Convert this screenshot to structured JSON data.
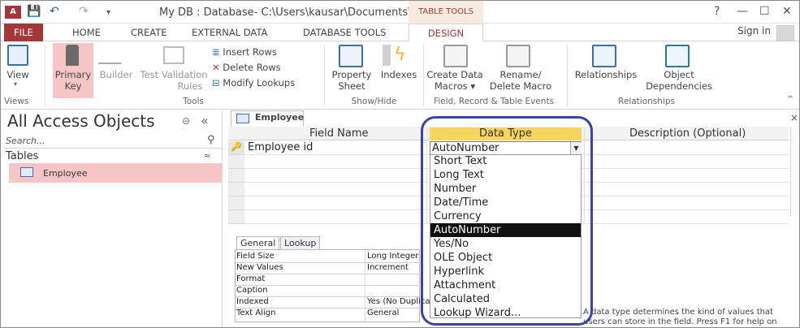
{
  "window": {
    "app_icon": "A",
    "title": "My DB : Database- C:\\Users\\kausar\\Documents\\...",
    "context_tab": "TABLE TOOLS",
    "help": "?",
    "minimize": "—",
    "maximize": "☐",
    "close": "✕"
  },
  "tabs": [
    "FILE",
    "HOME",
    "CREATE",
    "EXTERNAL DATA",
    "DATABASE TOOLS",
    "DESIGN"
  ],
  "signin": "Sign in",
  "ribbon": {
    "view": "View",
    "primary_key_1": "Primary",
    "primary_key_2": "Key",
    "builder": "Builder",
    "test_validation_1": "Test Validation",
    "test_validation_2": "Rules",
    "insert_rows": "Insert Rows",
    "delete_rows": "Delete Rows",
    "modify_lookups": "Modify Lookups",
    "property_sheet_1": "Property",
    "property_sheet_2": "Sheet",
    "indexes": "Indexes",
    "create_data_macros_1": "Create Data",
    "create_data_macros_2": "Macros ▾",
    "rename_delete_1": "Rename/",
    "rename_delete_2": "Delete Macro",
    "relationships": "Relationships",
    "object_dependencies_1": "Object",
    "object_dependencies_2": "Dependencies",
    "groups": [
      "Views",
      "Tools",
      "Show/Hide",
      "Field, Record & Table Events",
      "Relationships"
    ]
  },
  "nav": {
    "title": "All Access Objects",
    "search_placeholder": "Search...",
    "group": "Tables",
    "item": "Employee"
  },
  "doc": {
    "tab": "Employee",
    "headers": [
      "Field Name",
      "Data Type",
      "Description (Optional)"
    ],
    "field_name": "Employee id",
    "data_type": "AutoNumber",
    "options": [
      "Short Text",
      "Long Text",
      "Number",
      "Date/Time",
      "Currency",
      "AutoNumber",
      "Yes/No",
      "OLE Object",
      "Hyperlink",
      "Attachment",
      "Calculated",
      "Lookup Wizard..."
    ],
    "selected_option": "AutoNumber"
  },
  "props": {
    "tabs": [
      "General",
      "Lookup"
    ],
    "rows": [
      {
        "label": "Field Size",
        "value": "Long Integer"
      },
      {
        "label": "New Values",
        "value": "Increment"
      },
      {
        "label": "Format",
        "value": ""
      },
      {
        "label": "Caption",
        "value": ""
      },
      {
        "label": "Indexed",
        "value": "Yes (No Duplicates)"
      },
      {
        "label": "Text Align",
        "value": "General"
      }
    ],
    "help_text": "A data type determines the kind of values that users can store in the field. Press F1 for help on"
  },
  "colors": {
    "accent": "#a4373a",
    "highlight": "#3a44a8",
    "selected_row": "#f6c6c6",
    "header_active": "#f7d45c"
  }
}
